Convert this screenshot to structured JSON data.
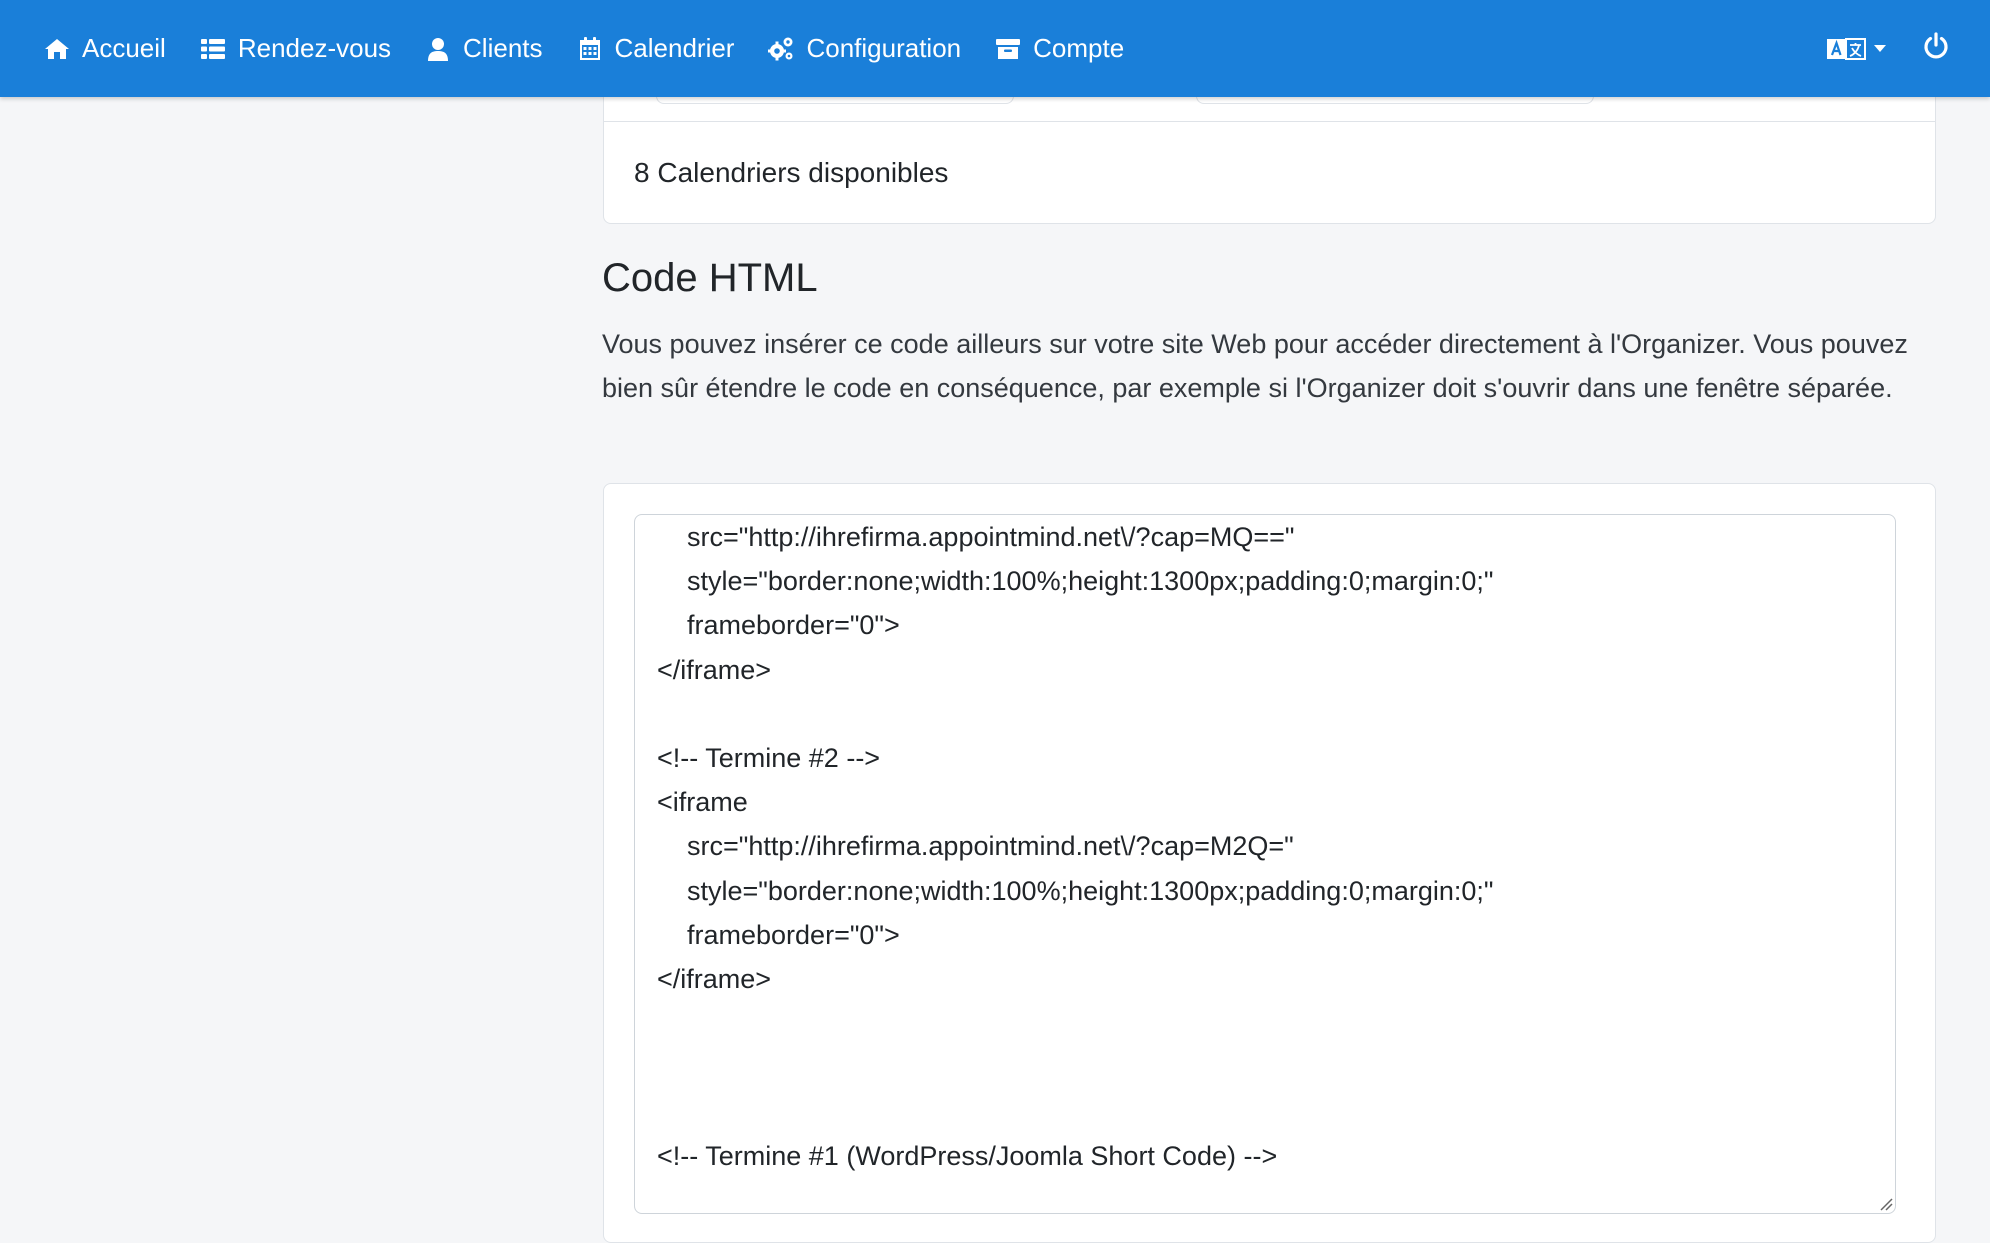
{
  "navbar": {
    "background": "#1a7fd9",
    "items": [
      {
        "label": "Accueil",
        "icon": "home-icon"
      },
      {
        "label": "Rendez-vous",
        "icon": "list-icon"
      },
      {
        "label": "Clients",
        "icon": "user-icon"
      },
      {
        "label": "Calendrier",
        "icon": "calendar-icon"
      },
      {
        "label": "Configuration",
        "icon": "cogs-icon"
      },
      {
        "label": "Compte",
        "icon": "archive-icon"
      }
    ],
    "language_icon": "language-icon",
    "power_icon": "power-icon"
  },
  "calendars_card": {
    "count_text": "8 Calendriers disponibles"
  },
  "html_section": {
    "title": "Code HTML",
    "description": "Vous pouvez insérer ce code ailleurs sur votre site Web pour accéder directement à l'Organizer. Vous pouvez bien sûr étendre le code en conséquence, par exemple si l'Organizer doit s'ouvrir dans une fenêtre séparée.",
    "code_lines": [
      "    src=\"http://ihrefirma.appointmind.net\\/?cap=MQ==\"",
      "    style=\"border:none;width:100%;height:1300px;padding:0;margin:0;\"",
      "    frameborder=\"0\">",
      "</iframe>",
      "",
      "<!-- Termine #2 -->",
      "<iframe",
      "    src=\"http://ihrefirma.appointmind.net\\/?cap=M2Q=\"",
      "    style=\"border:none;width:100%;height:1300px;padding:0;margin:0;\"",
      "    frameborder=\"0\">",
      "</iframe>",
      "",
      "",
      "",
      "<!-- Termine #1 (WordPress/Joomla Short Code) -->"
    ]
  }
}
